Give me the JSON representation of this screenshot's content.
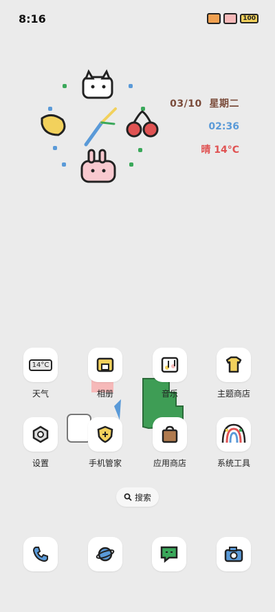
{
  "status": {
    "time": "8:16",
    "battery": "100"
  },
  "widget": {
    "date": "03/10",
    "weekday": "星期二",
    "time": "02:36",
    "weather": "晴 14°C"
  },
  "apps": [
    {
      "label": "天气",
      "icon": "weather-icon",
      "tile_text": "14°C"
    },
    {
      "label": "相册",
      "icon": "album-icon"
    },
    {
      "label": "音乐",
      "icon": "music-icon"
    },
    {
      "label": "主题商店",
      "icon": "theme-store-icon"
    },
    {
      "label": "设置",
      "icon": "settings-icon"
    },
    {
      "label": "手机管家",
      "icon": "phone-manager-icon"
    },
    {
      "label": "应用商店",
      "icon": "app-store-icon"
    },
    {
      "label": "系统工具",
      "icon": "system-tools-icon"
    }
  ],
  "search": {
    "label": "搜索"
  },
  "dock": [
    {
      "icon": "phone-icon"
    },
    {
      "icon": "browser-icon"
    },
    {
      "icon": "messages-icon"
    },
    {
      "icon": "camera-icon"
    }
  ],
  "colors": {
    "background": "#ebebeb",
    "date": "#7a4b3a",
    "time": "#5a9ad8",
    "weather": "#e05353"
  }
}
